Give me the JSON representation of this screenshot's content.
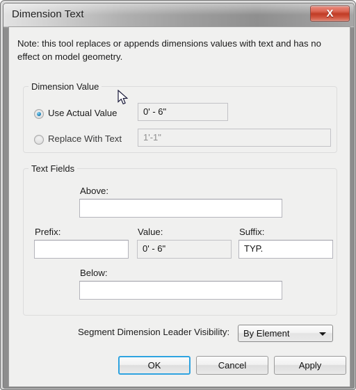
{
  "window": {
    "title": "Dimension Text",
    "close_label": "X",
    "close_icon": "close-icon"
  },
  "note": "Note: this tool replaces or appends dimensions values with text and has no effect on model geometry.",
  "dimension_value": {
    "group_title": "Dimension Value",
    "options": [
      {
        "label": "Use Actual Value",
        "selected": true,
        "value": "0' - 6\""
      },
      {
        "label": "Replace With Text",
        "selected": false,
        "value": "1'-1\""
      }
    ]
  },
  "text_fields": {
    "group_title": "Text Fields",
    "above": {
      "label": "Above:",
      "value": ""
    },
    "prefix": {
      "label": "Prefix:",
      "value": ""
    },
    "value": {
      "label": "Value:",
      "value": "0' - 6\""
    },
    "suffix": {
      "label": "Suffix:",
      "value": "TYP."
    },
    "below": {
      "label": "Below:",
      "value": ""
    }
  },
  "leader_visibility": {
    "label": "Segment Dimension Leader Visibility:",
    "selected": "By Element",
    "arrow_icon": "chevron-down-icon"
  },
  "buttons": {
    "ok": "OK",
    "cancel": "Cancel",
    "apply": "Apply"
  },
  "colors": {
    "accent": "#2ea3e0",
    "close_red": "#c03c26",
    "radio_blue": "#2b8fc4",
    "dialog_bg": "#f0f0ef"
  }
}
